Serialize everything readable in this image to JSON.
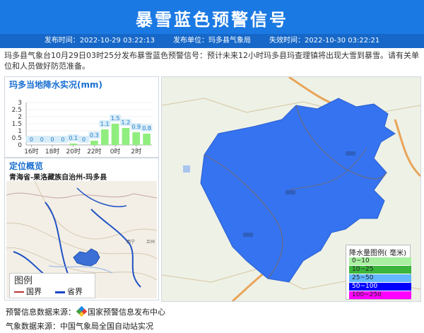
{
  "header": {
    "title": "暴雪蓝色预警信号",
    "publish_time": "发布时间：2022-10-29 03:22:13",
    "publisher": "发布单位：玛多县气象局",
    "expire_time": "失效时间：2022-10-30 03:22:21"
  },
  "description": "玛多县气象台10月29日03时25分发布暴雪蓝色预警信号：预计未来12小时玛多县玛查理镇将出现大雪到暴雪。请有关单位和人员做好防范准备。",
  "rain_panel": {
    "title": "玛多当地降水实况(mm)"
  },
  "chart_data": {
    "type": "bar",
    "title": "玛多当地降水实况(mm)",
    "categories": [
      "16时",
      "",
      "18时",
      "",
      "20时",
      "",
      "22时",
      "",
      "0时",
      "",
      "2时",
      ""
    ],
    "tick_labels": [
      "16时",
      "18时",
      "20时",
      "22时",
      "0时",
      "2时"
    ],
    "values": [
      0,
      0,
      0,
      0,
      0.1,
      0,
      0.3,
      1.1,
      1.5,
      1.2,
      0.9,
      0.8
    ],
    "ylim": [
      0,
      3
    ],
    "yticks": [
      "0",
      "0.5",
      "1",
      "1.5",
      "2",
      "2.5",
      "3"
    ],
    "bar_color": "#90ee7e",
    "label_color": "#d6ecf8"
  },
  "location": {
    "title": "定位概览",
    "region": "青海省-果洛藏族自治州-玛多县",
    "legend_title": "图例",
    "legend_country": "国界",
    "legend_province": "省界",
    "minimap_cities": [
      "西宁",
      "兰州"
    ]
  },
  "map_legend": {
    "title": "降水量图例( 毫米)",
    "items": [
      {
        "label": "0~10",
        "color": "#a8f0a0"
      },
      {
        "label": "10~25",
        "color": "#3bb53b"
      },
      {
        "label": "25~50",
        "color": "#63b8ff"
      },
      {
        "label": "50~100",
        "color": "#0000ff"
      },
      {
        "label": "100~250",
        "color": "#ff00ff"
      }
    ]
  },
  "footer": {
    "warning_source_label": "预警信息数据来源：",
    "warning_source": "国家预警信息发布中心",
    "weather_source": "气象数据来源：中国气象局全国自动站实况"
  },
  "colors": {
    "header_bg": "#1b79e3",
    "meta_bg": "#1667c7",
    "warning_area": "#3573f0",
    "accent_text": "#1a6fd1"
  }
}
